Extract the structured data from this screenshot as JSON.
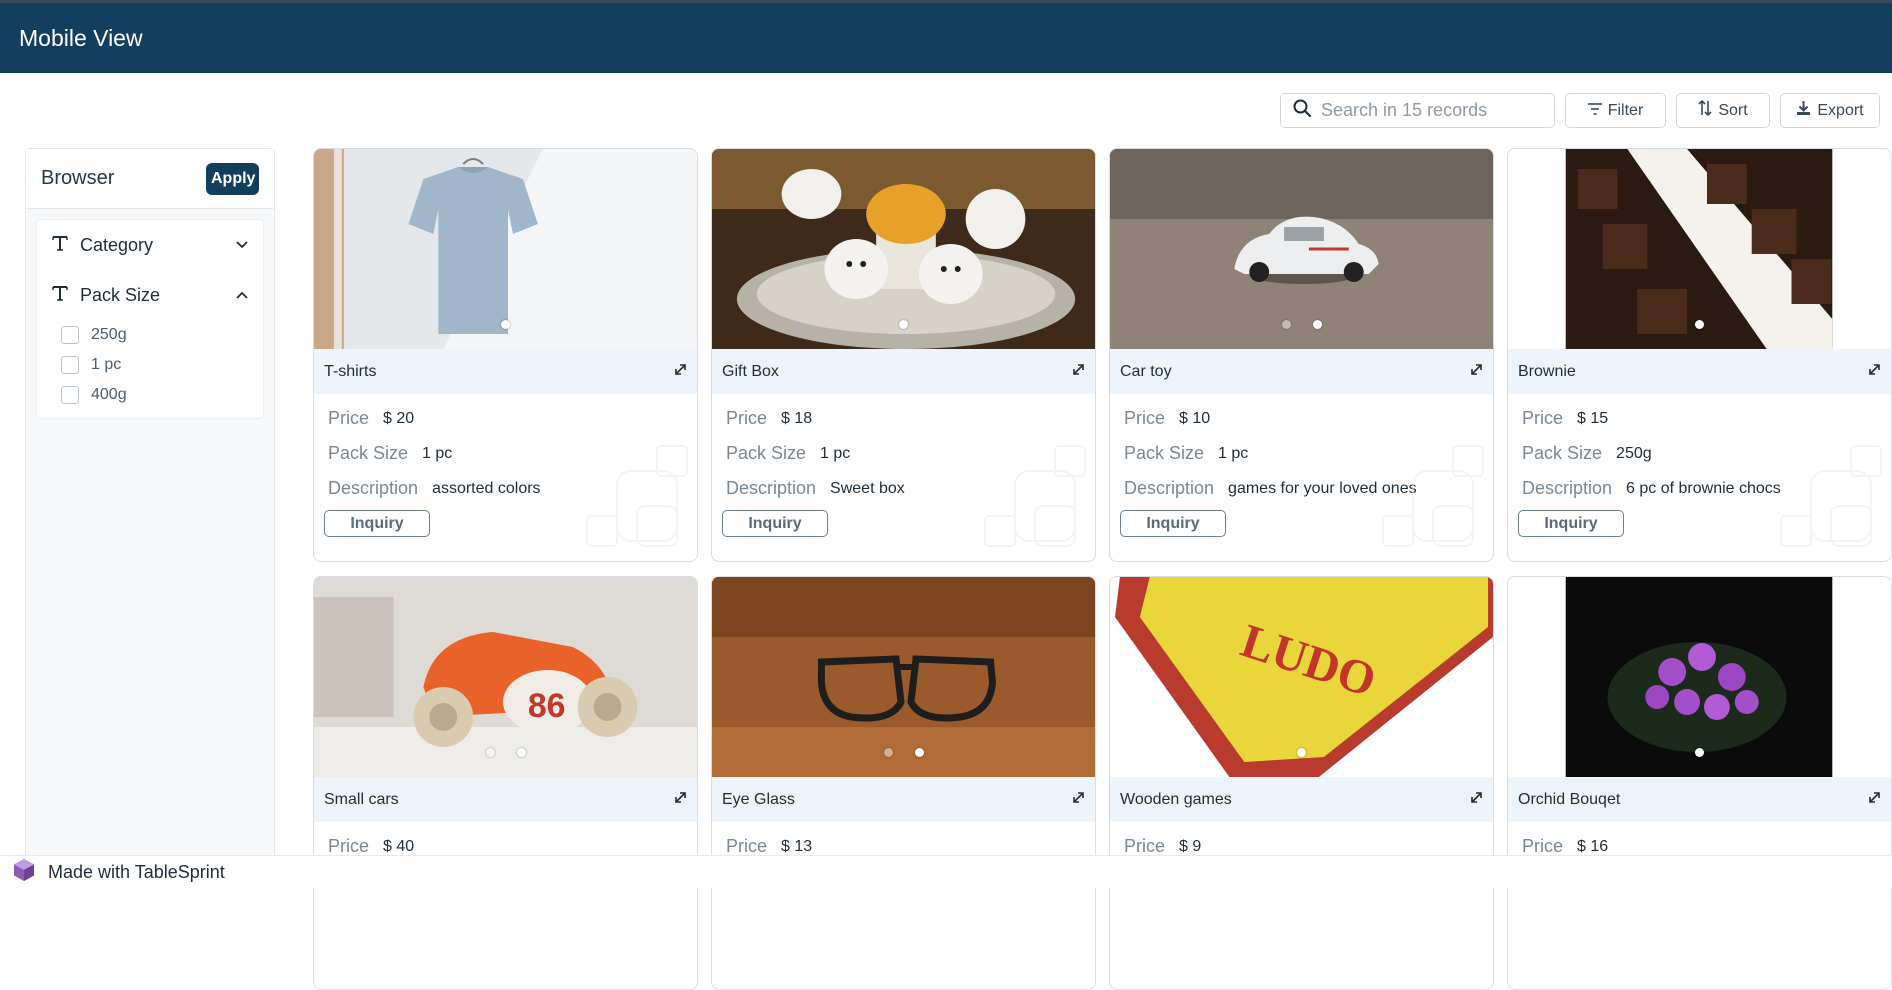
{
  "app": {
    "title": "Mobile View"
  },
  "toolbar": {
    "search_placeholder": "Search in 15 records",
    "filter_label": "Filter",
    "sort_label": "Sort",
    "export_label": "Export"
  },
  "sidebar": {
    "title": "Browser",
    "apply_label": "Apply",
    "facets": [
      {
        "label": "Category",
        "expanded": false
      },
      {
        "label": "Pack Size",
        "expanded": true,
        "options": [
          "250g",
          "1 pc",
          "400g"
        ]
      }
    ]
  },
  "field_labels": {
    "price": "Price",
    "pack_size": "Pack Size",
    "description": "Description"
  },
  "inquiry_label": "Inquiry",
  "cards": [
    {
      "title": "T-shirts",
      "price": "$ 20",
      "pack_size": "1 pc",
      "description": "assorted colors"
    },
    {
      "title": "Gift Box",
      "price": "$ 18",
      "pack_size": "1 pc",
      "description": "Sweet box"
    },
    {
      "title": "Car toy",
      "price": "$ 10",
      "pack_size": "1 pc",
      "description": "games for your loved ones"
    },
    {
      "title": "Brownie",
      "price": "$ 15",
      "pack_size": "250g",
      "description": "6 pc of brownie chocs"
    },
    {
      "title": "Small cars",
      "price": "$ 40"
    },
    {
      "title": "Eye Glass",
      "price": "$ 13"
    },
    {
      "title": "Wooden games",
      "price": "$ 9"
    },
    {
      "title": "Orchid Bouqet",
      "price": "$ 16"
    }
  ],
  "footer": {
    "label": "Made with TableSprint"
  },
  "colors": {
    "header_bg": "#133f5e",
    "card_title_bg": "#eef4fb",
    "accent": "#133f5e"
  }
}
